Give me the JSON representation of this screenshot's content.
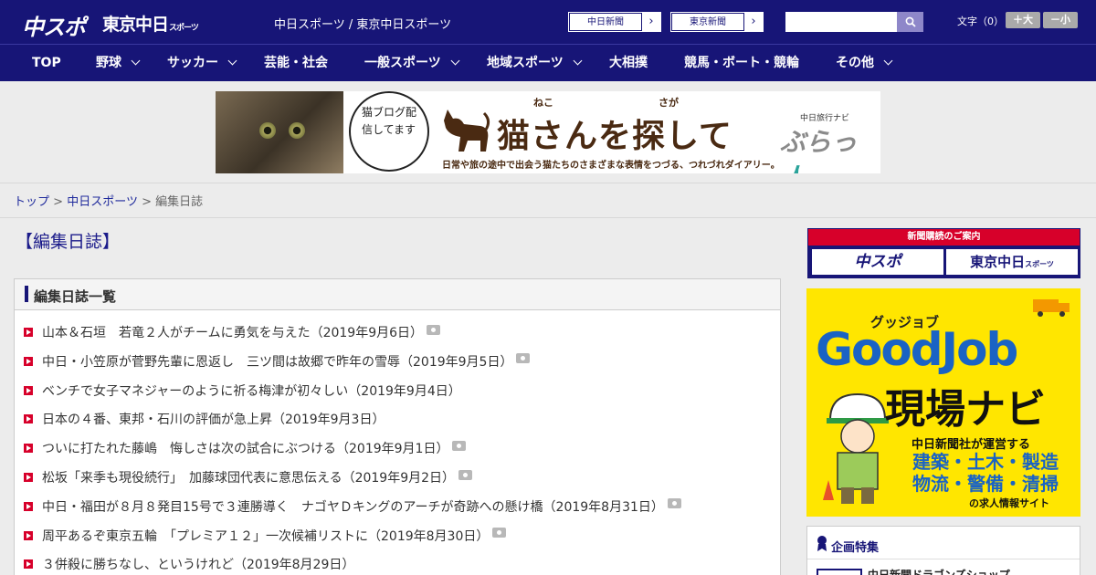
{
  "header": {
    "logo_main": "中スポ",
    "logo_tokyo": "東京中日",
    "logo_tokyo_small": "スポーツ",
    "site_description": "中日スポーツ / 東京中日スポーツ",
    "paper_buttons": [
      {
        "label": "中日新聞",
        "arrow": "›"
      },
      {
        "label": "東京新聞",
        "arrow": "›"
      }
    ],
    "search": {
      "placeholder": "",
      "button_icon": "search-icon"
    },
    "font_size": {
      "label": "文字（0）",
      "larger": "＋大",
      "smaller": "－小"
    }
  },
  "nav": {
    "items": [
      {
        "label": "TOP",
        "dropdown": false
      },
      {
        "label": "野球",
        "dropdown": true
      },
      {
        "label": "サッカー",
        "dropdown": true
      },
      {
        "label": "芸能・社会",
        "dropdown": false
      },
      {
        "label": "一般スポーツ",
        "dropdown": true
      },
      {
        "label": "地域スポーツ",
        "dropdown": true
      },
      {
        "label": "大相撲",
        "dropdown": false
      },
      {
        "label": "競馬・ボート・競輪",
        "dropdown": false
      },
      {
        "label": "その他",
        "dropdown": true
      }
    ]
  },
  "banner": {
    "bubble_text": "猫ブログ配信してます",
    "title": "猫さんを探して",
    "ruby_neko": "ねこ",
    "ruby_saga": "さが",
    "navi_label": "中日旅行ナビ",
    "brand_prefix": "ぶらっ",
    "brand_suffix": "人",
    "subtitle": "日常や旅の途中で出会う猫たちのさまざまな表情をつづる、つれづれダイアリー。"
  },
  "breadcrumb": {
    "items": [
      "トップ",
      "中日スポーツ"
    ],
    "separator": ">",
    "current": "編集日誌"
  },
  "page": {
    "title": "【編集日誌】",
    "list_title": "編集日誌一覧",
    "articles": [
      {
        "text": "山本＆石垣　若竜２人がチームに勇気を与えた（2019年9月6日）",
        "photo": true
      },
      {
        "text": "中日・小笠原が菅野先輩に恩返し　三ツ間は故郷で昨年の雪辱（2019年9月5日）",
        "photo": true
      },
      {
        "text": "ベンチで女子マネジャーのように祈る梅津が初々しい（2019年9月4日）",
        "photo": false
      },
      {
        "text": "日本の４番、東邦・石川の評価が急上昇（2019年9月3日）",
        "photo": false
      },
      {
        "text": "ついに打たれた藤嶋　悔しさは次の試合にぶつける（2019年9月1日）",
        "photo": true
      },
      {
        "text": "松坂「来季も現役続行」　加藤球団代表に意思伝える（2019年9月2日）",
        "photo": true
      },
      {
        "text": "中日・福田が８月８発目15号で３連勝導く　ナゴヤＤキングのアーチが奇跡への懸け橋（2019年8月31日）",
        "photo": true
      },
      {
        "text": "周平あるぞ東京五輪　「プレミア１２」一次候補リストに（2019年8月30日）",
        "photo": true
      },
      {
        "text": "３併殺に勝ちなし、というけれど（2019年8月29日）",
        "photo": false
      }
    ]
  },
  "sidebar": {
    "subscribe_head": "新聞購読のご案内",
    "subscribe_buttons": [
      "中スポ",
      "東京中日"
    ],
    "subscribe_small": "スポーツ",
    "goodjob": {
      "kana": "グッジョブ",
      "title": "GoodJob",
      "subtitle": "現場ナビ",
      "operator": "中日新聞社が運営する",
      "jobs_line1": "建築・土木・製造",
      "jobs_line2": "物流・警備・清掃",
      "tagline": "の求人情報サイト"
    },
    "feature_title": "企画特集",
    "feature_item": "中日新聞ドラゴンズショップ"
  }
}
